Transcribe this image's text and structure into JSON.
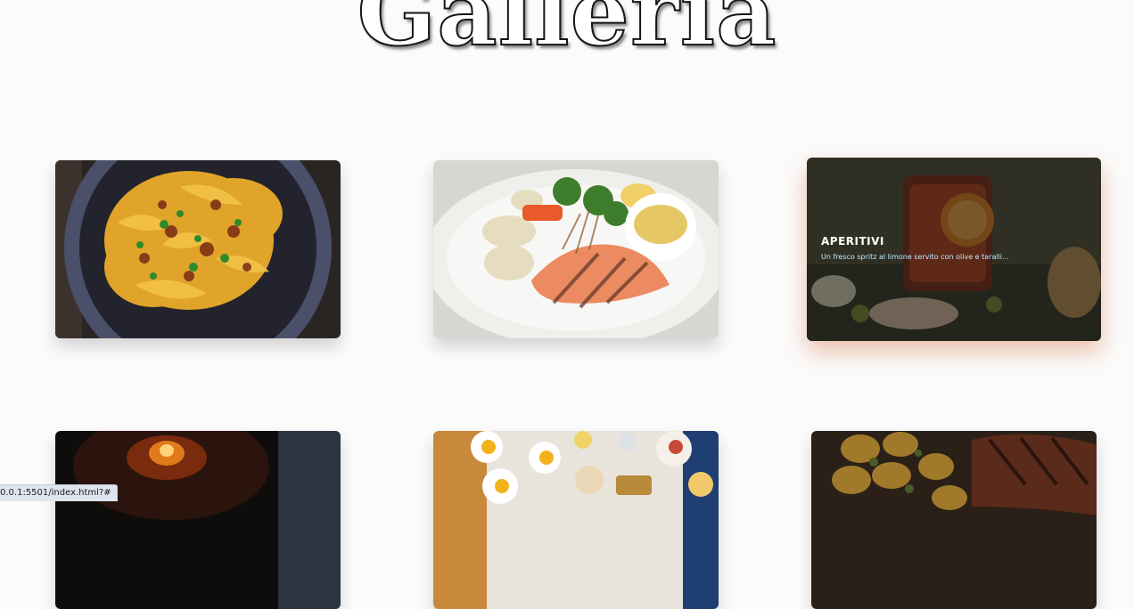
{
  "page": {
    "title": "Galleria"
  },
  "gallery": [
    {
      "name": "pasta",
      "caption_title": "",
      "caption_desc": ""
    },
    {
      "name": "salmon",
      "caption_title": "",
      "caption_desc": ""
    },
    {
      "name": "aperitivi",
      "caption_title": "APERITIVI",
      "caption_desc": "Un fresco spritz al limone servito con olive e taralli..."
    },
    {
      "name": "pizza-oven",
      "caption_title": "",
      "caption_desc": ""
    },
    {
      "name": "breakfast-table",
      "caption_title": "",
      "caption_desc": ""
    },
    {
      "name": "grilled-meat",
      "caption_title": "",
      "caption_desc": ""
    }
  ],
  "statusbar": {
    "url": "0.0.1:5501/index.html?#"
  }
}
